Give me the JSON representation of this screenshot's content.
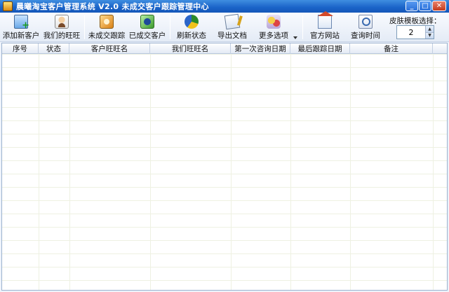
{
  "window": {
    "title": "晨曦淘宝客户管理系统 V2.0   未成交客户跟踪管理中心",
    "controls": [
      "minimize",
      "maximize",
      "close"
    ]
  },
  "toolbar": {
    "buttons": [
      {
        "label": "添加新客户",
        "icon": "add-customer-icon"
      },
      {
        "label": "我们的旺旺",
        "icon": "person-icon"
      },
      {
        "label": "未成交跟踪",
        "icon": "track-icon"
      },
      {
        "label": "已成交客户",
        "icon": "deal-icon"
      },
      {
        "label": "刷新状态",
        "icon": "refresh-icon"
      },
      {
        "label": "导出文档",
        "icon": "export-icon"
      },
      {
        "label": "更多选项",
        "icon": "more-options-icon"
      },
      {
        "label": "官方网站",
        "icon": "home-icon"
      },
      {
        "label": "查询时间",
        "icon": "search-time-icon"
      }
    ]
  },
  "skin": {
    "label": "皮肤模板选择：",
    "value": "2"
  },
  "grid": {
    "columns": [
      "序号",
      "状态",
      "客户旺旺名",
      "我们旺旺名",
      "第一次咨询日期",
      "最后跟踪日期",
      "备注"
    ],
    "rows": []
  },
  "colors": {
    "titlebar": "#1a63c8",
    "toolbar": "#e4ebf6",
    "grid_line": "#eef1e2"
  }
}
